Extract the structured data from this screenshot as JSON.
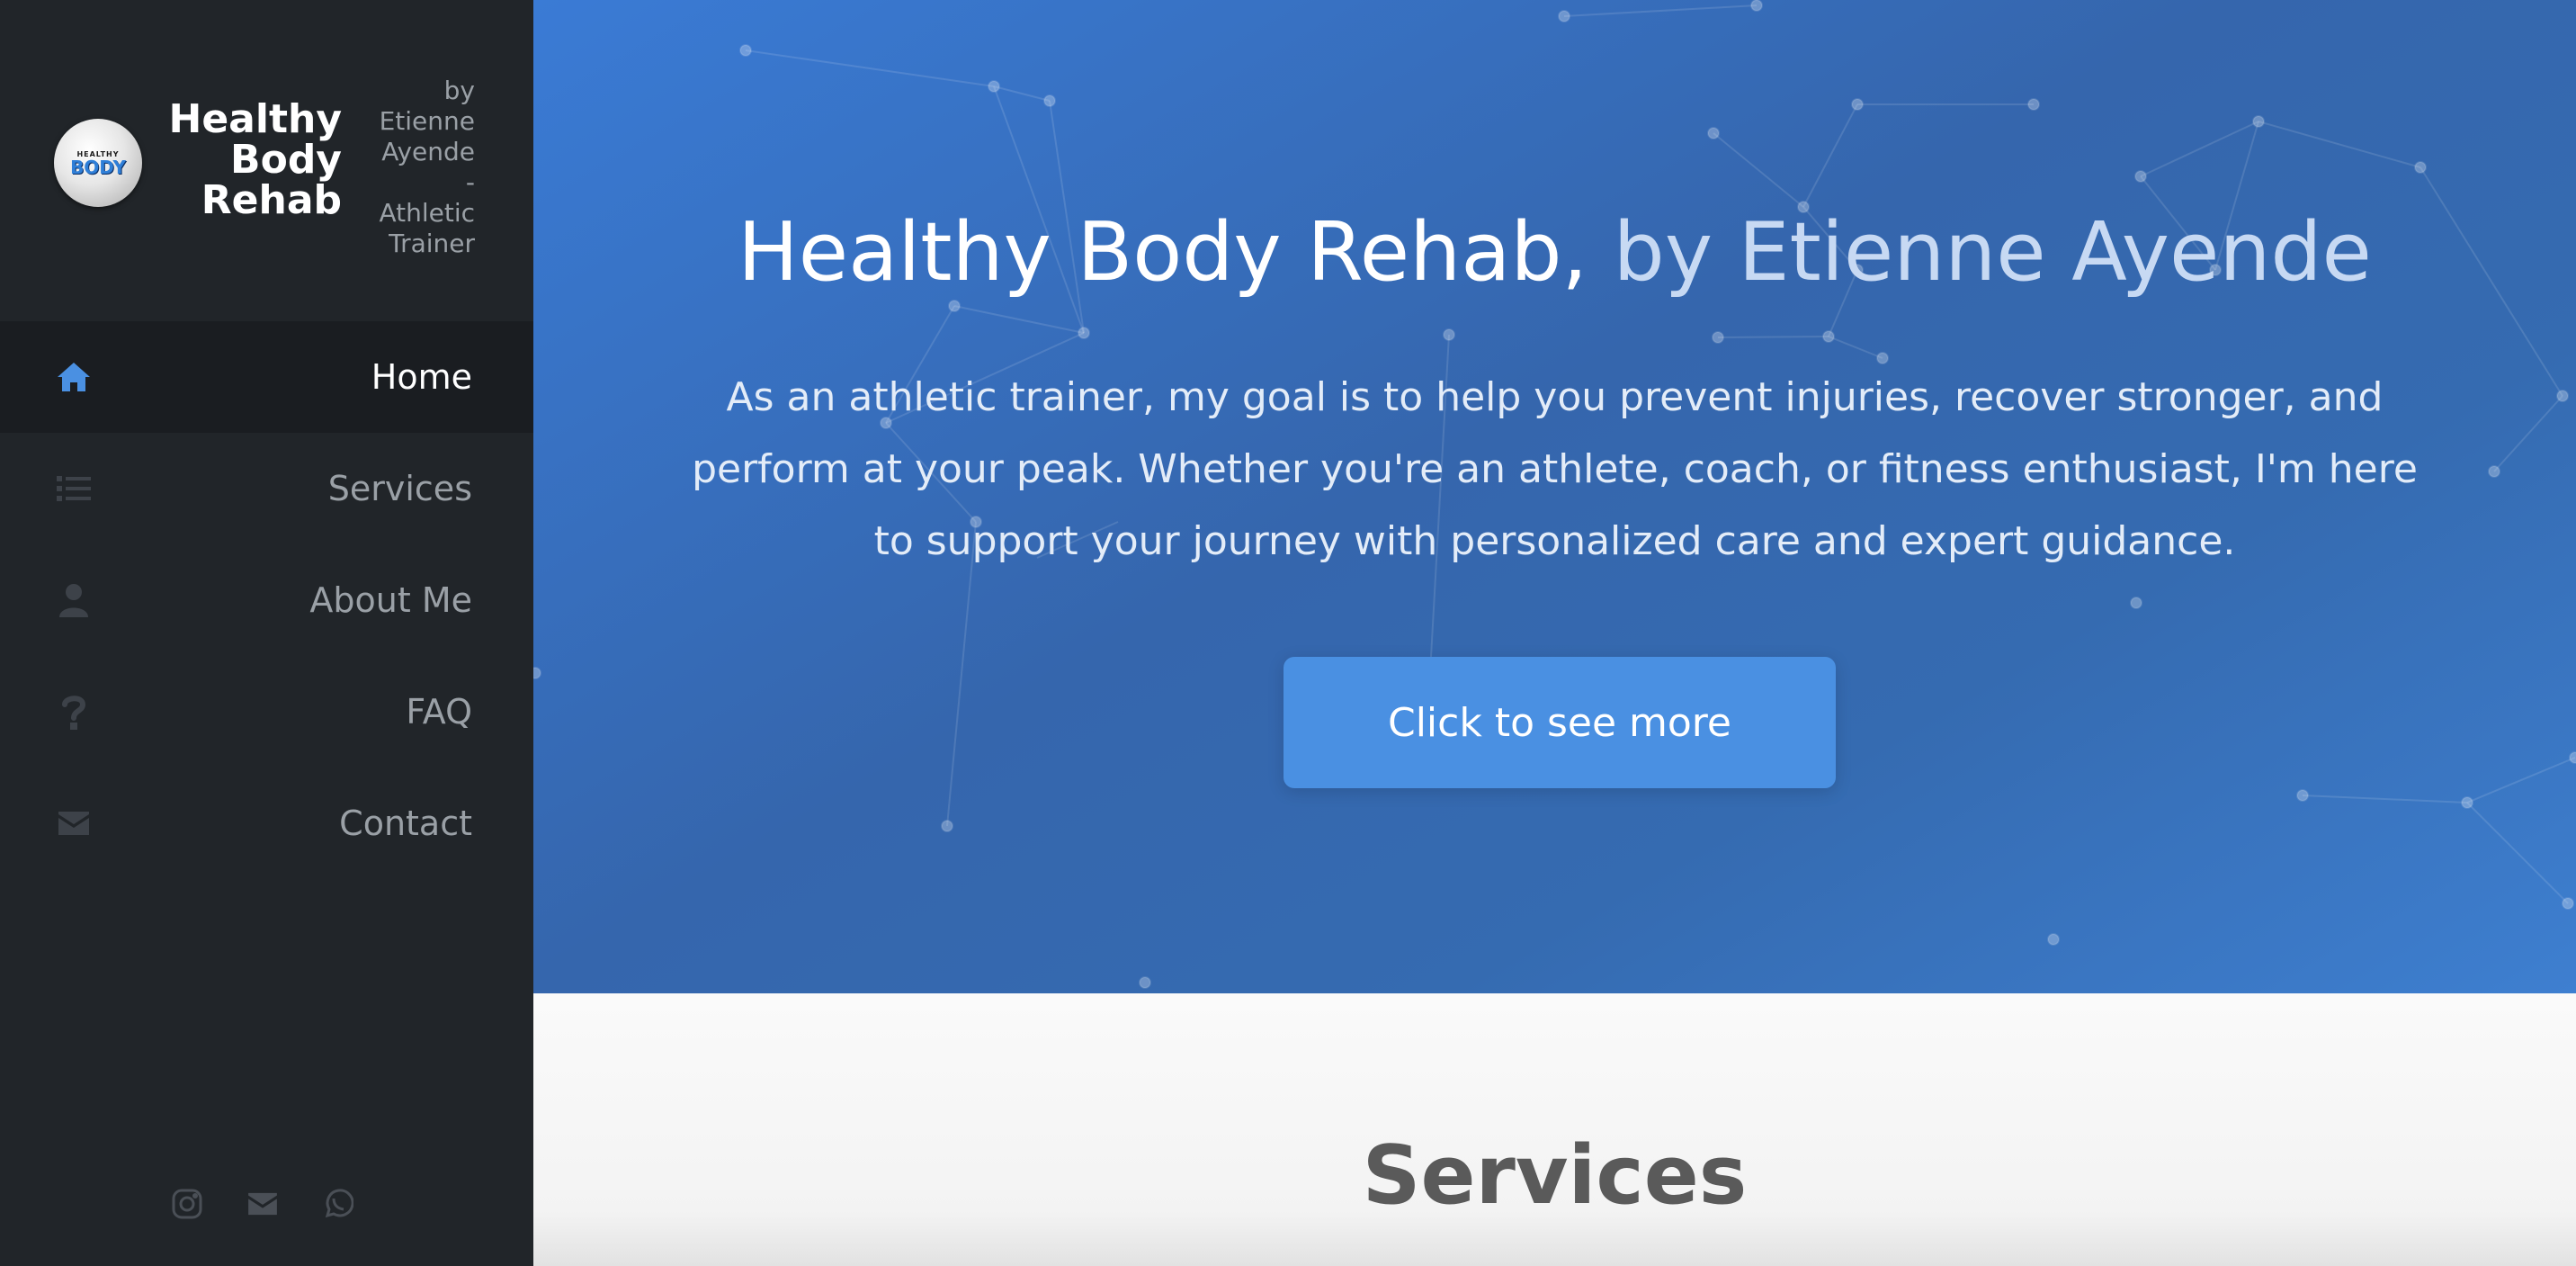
{
  "brand": {
    "logo_top": "HEALTHY",
    "logo_main": "BODY",
    "title_lines": [
      "Healthy",
      "Body",
      "Rehab"
    ],
    "subtitle_lines": [
      "by",
      "Etienne",
      "Ayende",
      "-",
      "Athletic",
      "Trainer"
    ]
  },
  "nav": {
    "items": [
      {
        "label": "Home",
        "icon": "home-icon",
        "active": true
      },
      {
        "label": "Services",
        "icon": "list-icon",
        "active": false
      },
      {
        "label": "About Me",
        "icon": "user-icon",
        "active": false
      },
      {
        "label": "FAQ",
        "icon": "question-icon",
        "active": false
      },
      {
        "label": "Contact",
        "icon": "envelope-icon",
        "active": false
      }
    ]
  },
  "social": [
    "instagram-icon",
    "envelope-icon",
    "whatsapp-icon"
  ],
  "hero": {
    "title_main": "Healthy Body Rehab,",
    "title_accent": " by Etienne Ayende",
    "text": "As an athletic trainer, my goal is to help you prevent injuries, recover stronger, and perform at your peak. Whether you're an athlete, coach, or fitness enthusiast, I'm here to support your journey with personalized care and expert guidance.",
    "cta_label": "Click to see more"
  },
  "services": {
    "title": "Services"
  },
  "colors": {
    "sidebar_bg": "#212529",
    "accent": "#4a90e2",
    "hero_bg": "#3a75c4"
  }
}
